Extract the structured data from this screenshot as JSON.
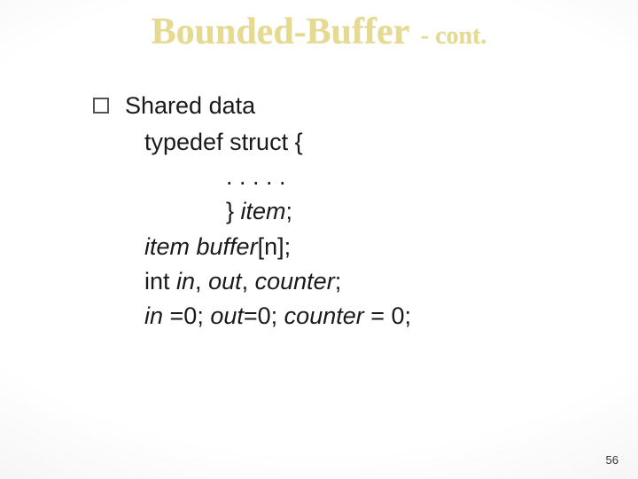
{
  "title": {
    "main": "Bounded-Buffer",
    "sub": "- cont."
  },
  "bullet": {
    "label": "Shared data"
  },
  "code": {
    "l1": "typedef struct {",
    "l2": ". . . . .",
    "l3_a": "} ",
    "l3_b": "item",
    "l3_c": ";",
    "l4_a": "item ",
    "l4_b": "buffer",
    "l4_c": "[n];",
    "l5_a": "int ",
    "l5_b": "in",
    "l5_c": ", ",
    "l5_d": "out",
    "l5_e": ", ",
    "l5_f": "counter",
    "l5_g": ";",
    "l6_a": "in ",
    "l6_b": "=0; ",
    "l6_c": "out",
    "l6_d": "=0; ",
    "l6_e": "counter ",
    "l6_f": "= 0;"
  },
  "page_number": "56"
}
